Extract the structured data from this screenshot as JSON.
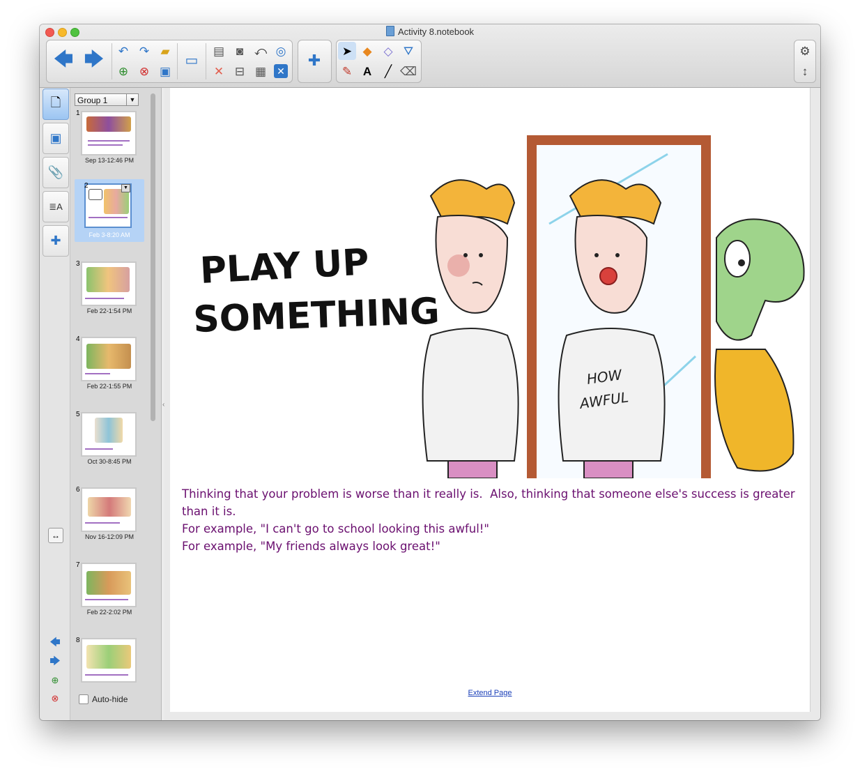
{
  "window": {
    "title": "Activity 8.notebook"
  },
  "toolbar": {
    "back_label": "Back",
    "forward_label": "Forward",
    "icons": [
      "undo-icon",
      "redo-icon",
      "open-icon",
      "add-page-icon",
      "delete-page-icon",
      "save-icon",
      "display-icon",
      "paste-icon",
      "screen-capture-icon",
      "screen-shade-icon",
      "record-icon",
      "clear-icon",
      "table-icon",
      "close-icon",
      "addon-puzzle-icon",
      "select-icon",
      "shapes-icon",
      "fill-icon",
      "lasso-icon",
      "pens-icon",
      "text-icon",
      "line-icon",
      "eraser-icon",
      "settings-icon",
      "move-toolbar-icon"
    ]
  },
  "sorter": {
    "group_label": "Group 1",
    "auto_hide_label": "Auto-hide",
    "pages": [
      {
        "num": "1",
        "date": "Sep 13-12:46 PM"
      },
      {
        "num": "2",
        "date": "Feb 3-8:20 AM"
      },
      {
        "num": "3",
        "date": "Feb 22-1:54 PM"
      },
      {
        "num": "4",
        "date": "Feb 22-1:55 PM"
      },
      {
        "num": "5",
        "date": "Oct 30-8:45 PM"
      },
      {
        "num": "6",
        "date": "Nov 16-12:09 PM"
      },
      {
        "num": "7",
        "date": "Feb 22-2:02 PM"
      },
      {
        "num": "8",
        "date": ""
      }
    ]
  },
  "page": {
    "heading_line1": "PLAY UP",
    "heading_line2": "SOMETHING",
    "shirt_line1": "HOW",
    "shirt_line2": "AWFUL",
    "text_lines": [
      "Thinking that your problem is worse than it really is.  Also, thinking that someone else's success is greater than it is.",
      "For example, \"I can't go to school looking this awful!\"",
      "For example, \"My friends always look great!\""
    ],
    "extend_label": "Extend Page"
  }
}
